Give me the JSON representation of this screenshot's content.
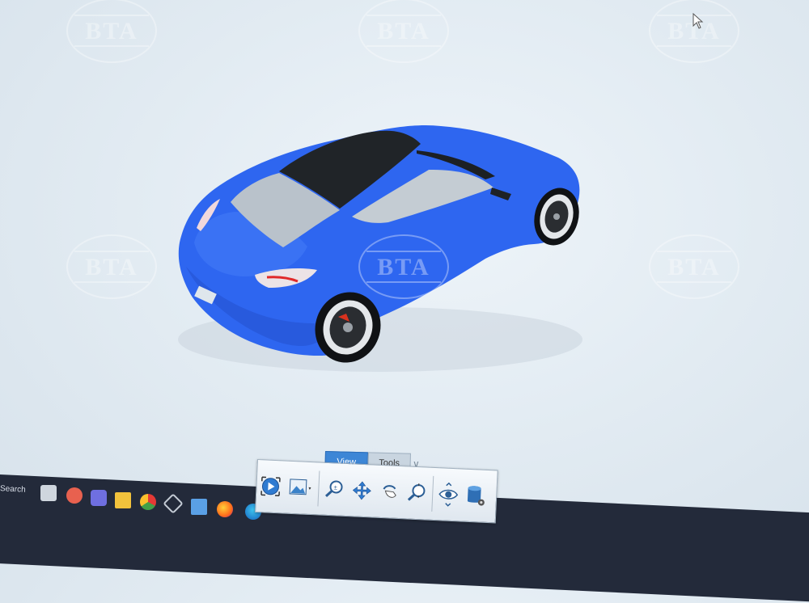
{
  "toolbar": {
    "tabs": [
      {
        "label": "View",
        "active": true
      },
      {
        "label": "Tools",
        "active": false
      }
    ],
    "tools": [
      {
        "icon": "zoom-fit-icon"
      },
      {
        "icon": "background-image-icon"
      },
      {
        "icon": "zoom-icon"
      },
      {
        "icon": "pan-icon"
      },
      {
        "icon": "rotate-hand-icon"
      },
      {
        "icon": "zoom-region-icon"
      },
      {
        "icon": "orbit-eye-icon"
      },
      {
        "icon": "database-settings-icon"
      }
    ]
  },
  "taskbar": {
    "search_label": "Search",
    "apps": [
      "files-icon",
      "people-icon",
      "teams-icon",
      "folder-icon",
      "chrome-icon",
      "app-cube-icon",
      "photos-icon",
      "firefox-icon",
      "edge-dev-icon"
    ]
  },
  "watermark": {
    "text": "BTA"
  },
  "colors": {
    "car_body": "#2e66f0",
    "toolbar_accent": "#3d86d6",
    "taskbar": "#232a3a"
  }
}
